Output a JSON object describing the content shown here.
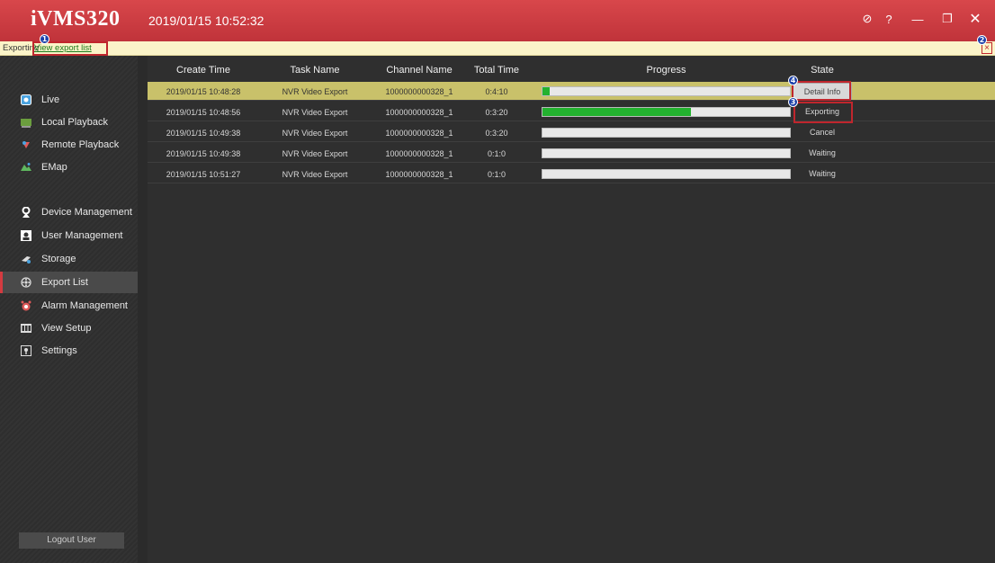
{
  "app": {
    "logo": "iVMS320",
    "datetime": "2019/01/15 10:52:32"
  },
  "window_controls": [
    {
      "name": "info-icon",
      "glyph": "⊘"
    },
    {
      "name": "help-icon",
      "glyph": "?"
    },
    {
      "name": "minimize-icon",
      "glyph": "—"
    },
    {
      "name": "restore-icon",
      "glyph": "❐"
    },
    {
      "name": "close-icon",
      "glyph": "✕"
    }
  ],
  "notice": {
    "label": "Exporting",
    "link": "View export list",
    "close": "×",
    "markers": [
      "1",
      "2"
    ]
  },
  "sidebar": {
    "items": [
      {
        "label": "Live",
        "icon": "live-icon"
      },
      {
        "label": "Local Playback",
        "icon": "local-playback-icon"
      },
      {
        "label": "Remote Playback",
        "icon": "remote-playback-icon"
      },
      {
        "label": "EMap",
        "icon": "emap-icon"
      },
      {
        "label": "Device Management",
        "icon": "device-management-icon"
      },
      {
        "label": "User Management",
        "icon": "user-management-icon"
      },
      {
        "label": "Storage",
        "icon": "storage-icon"
      },
      {
        "label": "Export List",
        "icon": "export-list-icon",
        "active": true
      },
      {
        "label": "Alarm Management",
        "icon": "alarm-icon"
      },
      {
        "label": "View Setup",
        "icon": "view-setup-icon"
      },
      {
        "label": "Settings",
        "icon": "settings-icon"
      }
    ],
    "logout": "Logout User"
  },
  "table": {
    "headers": {
      "create_time": "Create Time",
      "task_name": "Task Name",
      "channel_name": "Channel Name",
      "total_time": "Total Time",
      "progress": "Progress",
      "state": "State"
    },
    "rows": [
      {
        "create_time": "2019/01/15 10:48:28",
        "task_name": "NVR Video Export",
        "channel_name": "1000000000328_1",
        "total_time": "0:4:10",
        "progress": 0.03,
        "state": "Detail Info"
      },
      {
        "create_time": "2019/01/15 10:48:56",
        "task_name": "NVR Video Export",
        "channel_name": "1000000000328_1",
        "total_time": "0:3:20",
        "progress": 0.6,
        "state": "Exporting"
      },
      {
        "create_time": "2019/01/15 10:49:38",
        "task_name": "NVR Video Export",
        "channel_name": "1000000000328_1",
        "total_time": "0:3:20",
        "progress": 0,
        "state": "Cancel"
      },
      {
        "create_time": "2019/01/15 10:49:38",
        "task_name": "NVR Video Export",
        "channel_name": "1000000000328_1",
        "total_time": "0:1:0",
        "progress": 0,
        "state": "Waiting"
      },
      {
        "create_time": "2019/01/15 10:51:27",
        "task_name": "NVR Video Export",
        "channel_name": "1000000000328_1",
        "total_time": "0:1:0",
        "progress": 0,
        "state": "Waiting"
      }
    ],
    "markers": [
      "4",
      "3"
    ]
  },
  "colors": {
    "titlebar": "#c9353b",
    "selected_row": "#c9c16a",
    "progress_fill": "#23b22f",
    "highlight": "#c0262d"
  }
}
